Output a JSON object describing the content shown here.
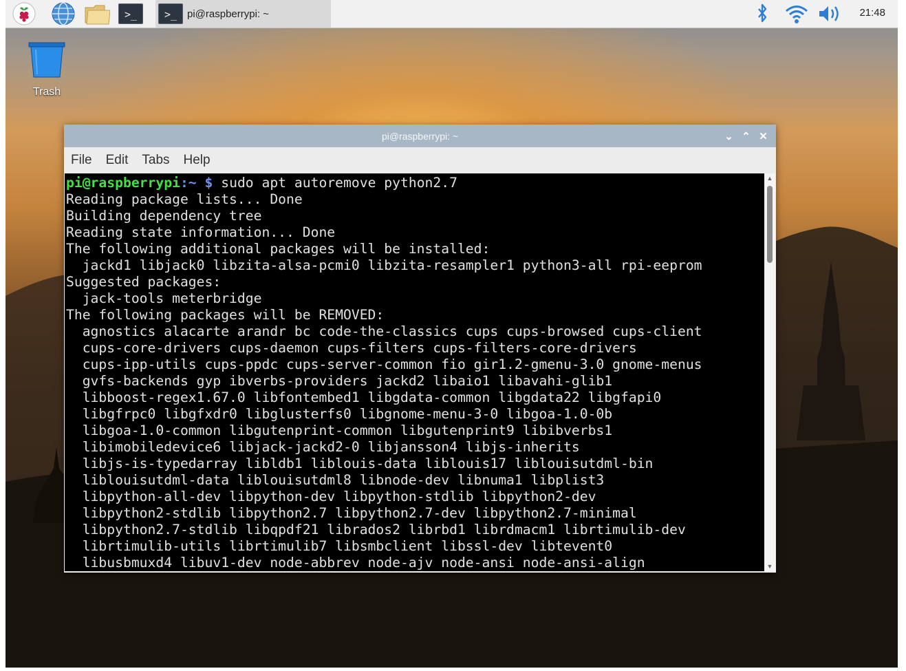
{
  "taskbar": {
    "launchers": [
      "raspberry-menu",
      "web-browser",
      "file-manager",
      "terminal"
    ],
    "task": {
      "label": "pi@raspberrypi: ~"
    },
    "clock": "21:48"
  },
  "desktop": {
    "trash_label": "Trash"
  },
  "terminal_window": {
    "title": "pi@raspberrypi: ~",
    "menu": [
      "File",
      "Edit",
      "Tabs",
      "Help"
    ],
    "prompt_user": "pi@raspberrypi",
    "prompt_path": ":~",
    "prompt_symbol": " $ ",
    "command": "sudo apt autoremove python2.7",
    "lines": [
      "Reading package lists... Done",
      "Building dependency tree",
      "Reading state information... Done",
      "The following additional packages will be installed:",
      "  jackd1 libjack0 libzita-alsa-pcmi0 libzita-resampler1 python3-all rpi-eeprom",
      "Suggested packages:",
      "  jack-tools meterbridge",
      "The following packages will be REMOVED:",
      "  agnostics alacarte arandr bc code-the-classics cups cups-browsed cups-client",
      "  cups-core-drivers cups-daemon cups-filters cups-filters-core-drivers",
      "  cups-ipp-utils cups-ppdc cups-server-common fio gir1.2-gmenu-3.0 gnome-menus",
      "  gvfs-backends gyp ibverbs-providers jackd2 libaio1 libavahi-glib1",
      "  libboost-regex1.67.0 libfontembed1 libgdata-common libgdata22 libgfapi0",
      "  libgfrpc0 libgfxdr0 libglusterfs0 libgnome-menu-3-0 libgoa-1.0-0b",
      "  libgoa-1.0-common libgutenprint-common libgutenprint9 libibverbs1",
      "  libimobiledevice6 libjack-jackd2-0 libjansson4 libjs-inherits",
      "  libjs-is-typedarray libldb1 liblouis-data liblouis17 liblouisutdml-bin",
      "  liblouisutdml-data liblouisutdml8 libnode-dev libnuma1 libplist3",
      "  libpython-all-dev libpython-dev libpython-stdlib libpython2-dev",
      "  libpython2-stdlib libpython2.7 libpython2.7-dev libpython2.7-minimal",
      "  libpython2.7-stdlib libqpdf21 librados2 librbd1 librdmacm1 librtimulib-dev",
      "  librtimulib-utils librtimulib7 libsmbclient libssl-dev libtevent0",
      "  libusbmuxd4 libuv1-dev node-abbrev node-ajv node-ansi node-ansi-align"
    ]
  },
  "colors": {
    "prompt_user": "#3fe33f",
    "prompt_symbol": "#6f8ff5",
    "titlebar": "#a7b7c6",
    "terminal_bg": "#000000"
  }
}
